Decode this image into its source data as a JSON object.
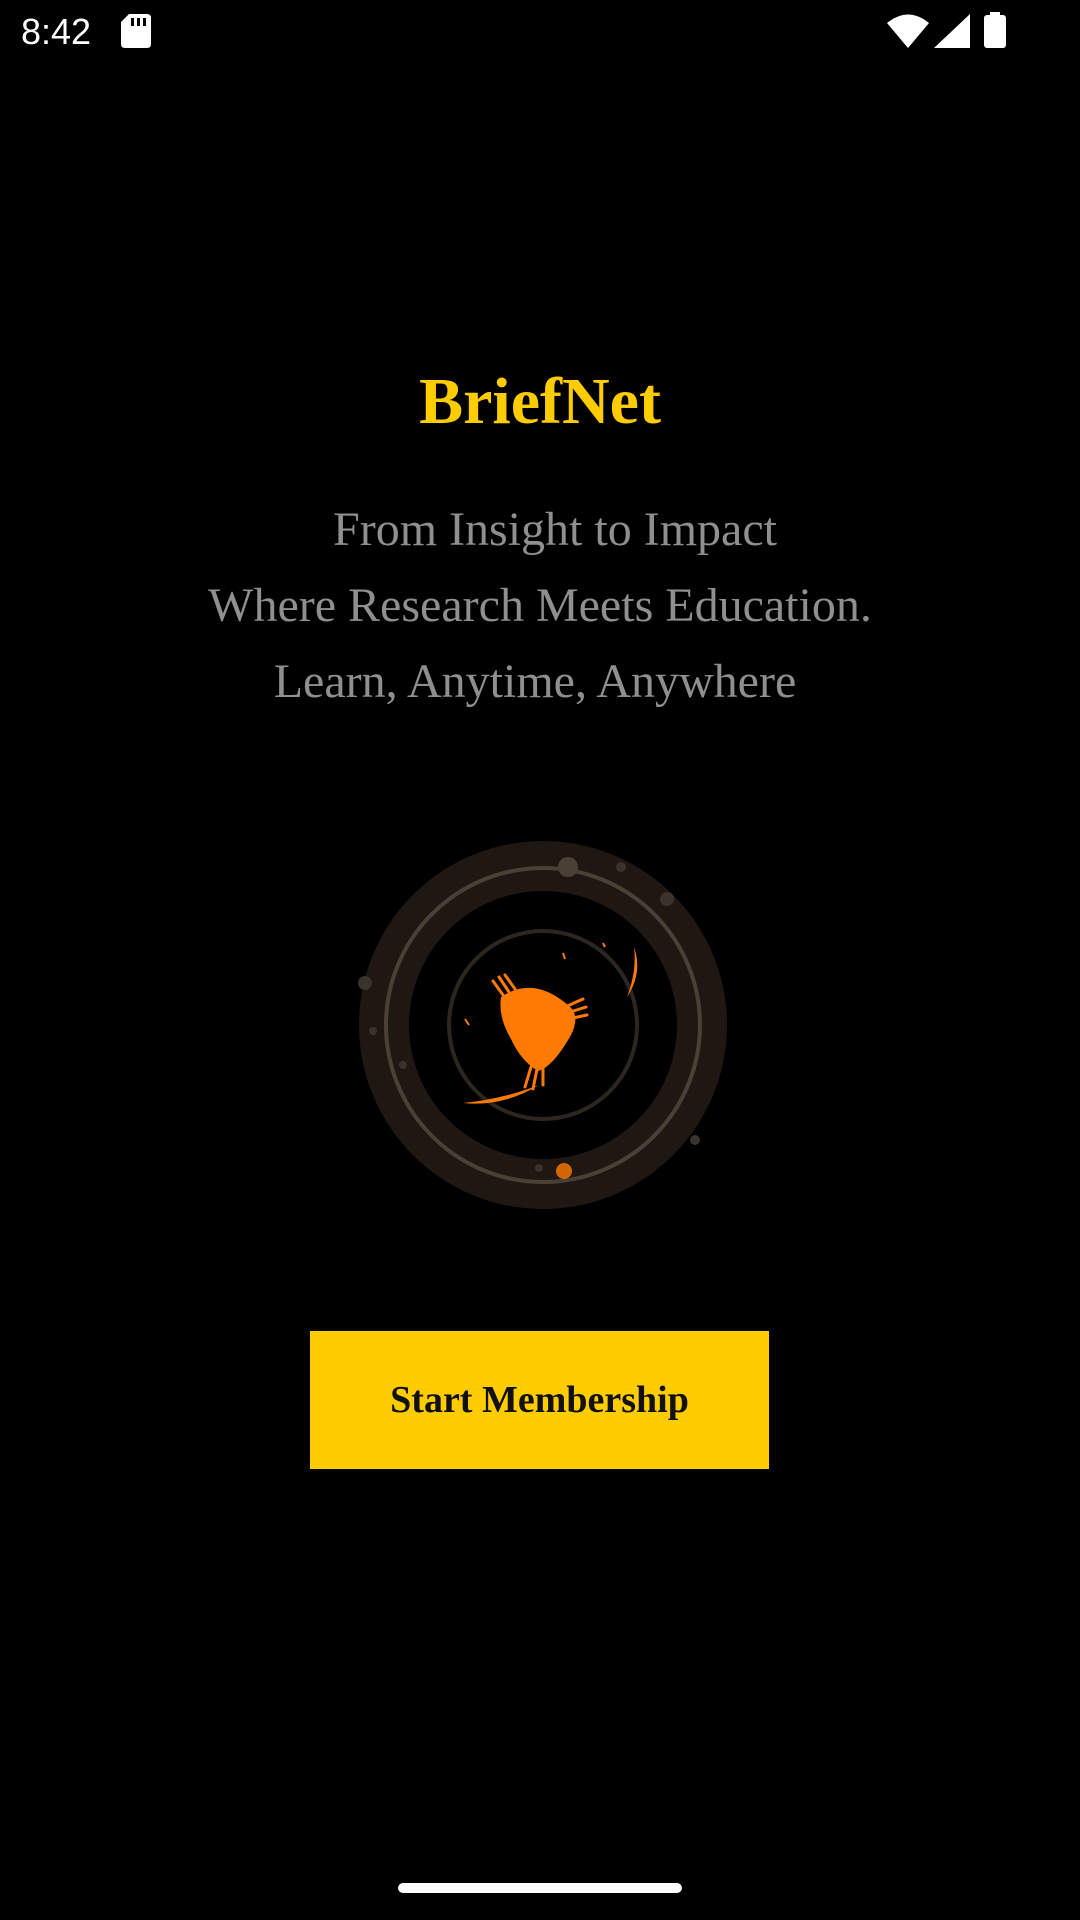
{
  "status_bar": {
    "time": "8:42",
    "icons": [
      "sd-card-icon",
      "wifi-icon",
      "signal-icon",
      "battery-icon"
    ]
  },
  "app": {
    "title": "BriefNet",
    "tagline": [
      "From Insight to Impact",
      "Where Research Meets Education.",
      "Learn, Anytime, Anywhere"
    ]
  },
  "loader": {
    "icon": "loading-animation-icon"
  },
  "cta": {
    "label": "Start Membership"
  },
  "colors": {
    "background": "#000000",
    "accent": "#ffcc00",
    "tagline": "#8f8f8f",
    "loader_orange": "#ff7a00",
    "ring_dark": "#1e1712",
    "ring_line": "#4a4036"
  }
}
